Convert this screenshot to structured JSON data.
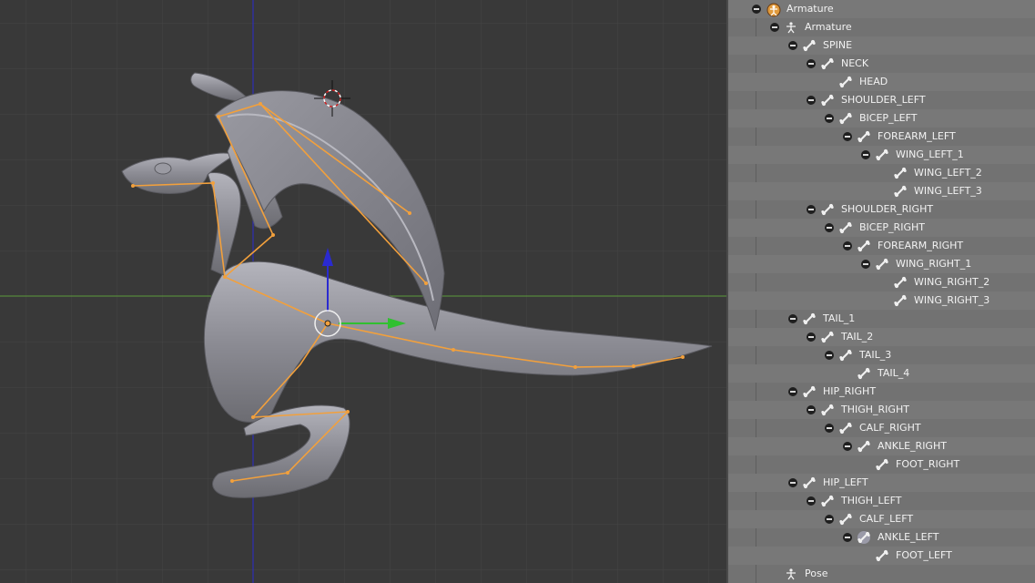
{
  "outliner": {
    "items": [
      {
        "label": "Armature",
        "depth": 0,
        "icon": "armature-object-icon",
        "toggle": true,
        "name": "outliner-item-armature-object"
      },
      {
        "label": "Armature",
        "depth": 1,
        "icon": "armature-data-icon",
        "toggle": true,
        "name": "outliner-item-armature-data"
      },
      {
        "label": "SPINE",
        "depth": 2,
        "icon": "bone-icon",
        "toggle": true,
        "name": "outliner-item-spine"
      },
      {
        "label": "NECK",
        "depth": 3,
        "icon": "bone-icon",
        "toggle": true,
        "name": "outliner-item-neck"
      },
      {
        "label": "HEAD",
        "depth": 4,
        "icon": "bone-icon",
        "toggle": false,
        "name": "outliner-item-head"
      },
      {
        "label": "SHOULDER_LEFT",
        "depth": 3,
        "icon": "bone-icon",
        "toggle": true,
        "name": "outliner-item-shoulder-left"
      },
      {
        "label": "BICEP_LEFT",
        "depth": 4,
        "icon": "bone-icon",
        "toggle": true,
        "name": "outliner-item-bicep-left"
      },
      {
        "label": "FOREARM_LEFT",
        "depth": 5,
        "icon": "bone-icon",
        "toggle": true,
        "name": "outliner-item-forearm-left"
      },
      {
        "label": "WING_LEFT_1",
        "depth": 6,
        "icon": "bone-icon",
        "toggle": true,
        "name": "outliner-item-wing-left-1"
      },
      {
        "label": "WING_LEFT_2",
        "depth": 7,
        "icon": "bone-icon",
        "toggle": false,
        "name": "outliner-item-wing-left-2"
      },
      {
        "label": "WING_LEFT_3",
        "depth": 7,
        "icon": "bone-icon",
        "toggle": false,
        "name": "outliner-item-wing-left-3"
      },
      {
        "label": "SHOULDER_RIGHT",
        "depth": 3,
        "icon": "bone-icon",
        "toggle": true,
        "name": "outliner-item-shoulder-right"
      },
      {
        "label": "BICEP_RIGHT",
        "depth": 4,
        "icon": "bone-icon",
        "toggle": true,
        "name": "outliner-item-bicep-right"
      },
      {
        "label": "FOREARM_RIGHT",
        "depth": 5,
        "icon": "bone-icon",
        "toggle": true,
        "name": "outliner-item-forearm-right"
      },
      {
        "label": "WING_RIGHT_1",
        "depth": 6,
        "icon": "bone-icon",
        "toggle": true,
        "name": "outliner-item-wing-right-1"
      },
      {
        "label": "WING_RIGHT_2",
        "depth": 7,
        "icon": "bone-icon",
        "toggle": false,
        "name": "outliner-item-wing-right-2"
      },
      {
        "label": "WING_RIGHT_3",
        "depth": 7,
        "icon": "bone-icon",
        "toggle": false,
        "name": "outliner-item-wing-right-3"
      },
      {
        "label": "TAIL_1",
        "depth": 2,
        "icon": "bone-icon",
        "toggle": true,
        "name": "outliner-item-tail-1"
      },
      {
        "label": "TAIL_2",
        "depth": 3,
        "icon": "bone-icon",
        "toggle": true,
        "name": "outliner-item-tail-2"
      },
      {
        "label": "TAIL_3",
        "depth": 4,
        "icon": "bone-icon",
        "toggle": true,
        "name": "outliner-item-tail-3"
      },
      {
        "label": "TAIL_4",
        "depth": 5,
        "icon": "bone-icon",
        "toggle": false,
        "name": "outliner-item-tail-4"
      },
      {
        "label": "HIP_RIGHT",
        "depth": 2,
        "icon": "bone-icon",
        "toggle": true,
        "name": "outliner-item-hip-right"
      },
      {
        "label": "THIGH_RIGHT",
        "depth": 3,
        "icon": "bone-icon",
        "toggle": true,
        "name": "outliner-item-thigh-right"
      },
      {
        "label": "CALF_RIGHT",
        "depth": 4,
        "icon": "bone-icon",
        "toggle": true,
        "name": "outliner-item-calf-right"
      },
      {
        "label": "ANKLE_RIGHT",
        "depth": 5,
        "icon": "bone-icon",
        "toggle": true,
        "name": "outliner-item-ankle-right"
      },
      {
        "label": "FOOT_RIGHT",
        "depth": 6,
        "icon": "bone-icon",
        "toggle": false,
        "name": "outliner-item-foot-right"
      },
      {
        "label": "HIP_LEFT",
        "depth": 2,
        "icon": "bone-icon",
        "toggle": true,
        "name": "outliner-item-hip-left"
      },
      {
        "label": "THIGH_LEFT",
        "depth": 3,
        "icon": "bone-icon",
        "toggle": true,
        "name": "outliner-item-thigh-left"
      },
      {
        "label": "CALF_LEFT",
        "depth": 4,
        "icon": "bone-icon",
        "toggle": true,
        "name": "outliner-item-calf-left"
      },
      {
        "label": "ANKLE_LEFT",
        "depth": 5,
        "icon": "bone-icon",
        "toggle": true,
        "active": true,
        "name": "outliner-item-ankle-left"
      },
      {
        "label": "FOOT_LEFT",
        "depth": 6,
        "icon": "bone-icon",
        "toggle": false,
        "name": "outliner-item-foot-left"
      },
      {
        "label": "Pose",
        "depth": 1,
        "icon": "pose-icon",
        "toggle": false,
        "name": "outliner-item-pose"
      }
    ]
  },
  "colors": {
    "viewport_bg": "#393939",
    "grid": "#454545",
    "x_axis": "#5c9a3a",
    "z_axis": "#2a2ad0",
    "bone": "#f2a03c",
    "mesh": "#8c8c94",
    "outliner_bg": "#727272",
    "outliner_alt": "#787878",
    "object_icon": "#e09a3c"
  }
}
